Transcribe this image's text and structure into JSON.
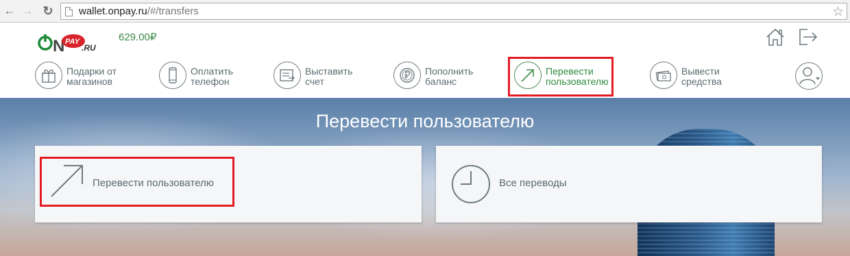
{
  "browser": {
    "url_host": "wallet.onpay.ru",
    "url_path": "/#/transfers"
  },
  "header": {
    "logo_icons": [
      "power-icon"
    ],
    "balance": "629.00",
    "currency": "₽",
    "icons": [
      "home-icon",
      "logout-icon"
    ]
  },
  "menu": {
    "items": [
      {
        "line1": "Подарки от",
        "line2": "магазинов",
        "icon": "gift-icon"
      },
      {
        "line1": "Оплатить",
        "line2": "телефон",
        "icon": "phone-icon"
      },
      {
        "line1": "Выставить",
        "line2": "счет",
        "icon": "invoice-icon"
      },
      {
        "line1": "Пополнить",
        "line2": "баланс",
        "icon": "ruble-coin-icon"
      },
      {
        "line1": "Перевести",
        "line2": "пользователю",
        "icon": "arrow-up-right-icon",
        "active": true
      },
      {
        "line1": "Вывести",
        "line2": "средства",
        "icon": "banknotes-icon"
      }
    ],
    "profile_icon": "user-icon"
  },
  "page": {
    "title": "Перевести пользователю"
  },
  "cards": {
    "transfer_label": "Перевести пользователю",
    "all_label": "Все переводы"
  },
  "colors": {
    "brand_green": "#2f8a3f",
    "highlight_red": "#e31b23",
    "text_gray": "#5b6b70"
  }
}
